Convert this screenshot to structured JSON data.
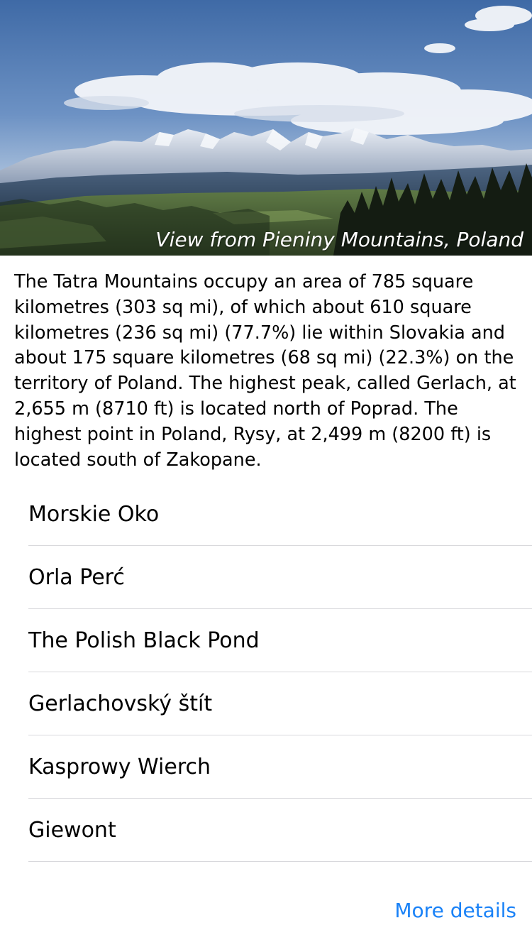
{
  "hero": {
    "caption": "View from Pieniny Mountains, Poland"
  },
  "description": "The Tatra Mountains occupy an area of 785 square kilometres (303 sq mi), of which about 610 square kilometres (236 sq mi) (77.7%) lie within Slovakia and about 175 square kilometres (68 sq mi) (22.3%) on the territory of Poland. The highest peak, called Gerlach, at 2,655 m (8710 ft) is located north of Poprad. The highest point in Poland, Rysy, at 2,499 m (8200 ft) is located south of Zakopane.",
  "places": [
    {
      "label": "Morskie Oko"
    },
    {
      "label": "Orla Perć"
    },
    {
      "label": "The Polish Black Pond"
    },
    {
      "label": "Gerlachovský štít"
    },
    {
      "label": "Kasprowy Wierch"
    },
    {
      "label": "Giewont"
    }
  ],
  "more_details_label": "More details",
  "colors": {
    "link": "#1a82f7",
    "separator": "#d8d8dc"
  }
}
